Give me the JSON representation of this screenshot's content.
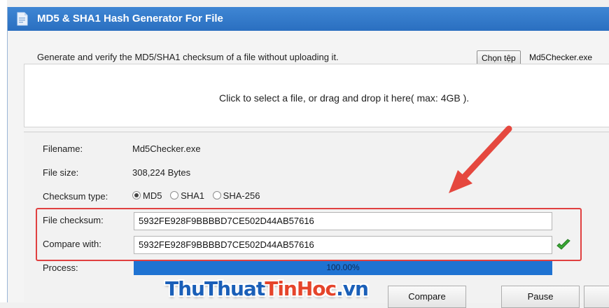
{
  "window": {
    "title": "MD5 & SHA1 Hash Generator For File"
  },
  "header": {
    "description": "Generate and verify the MD5/SHA1 checksum of a file without uploading it.",
    "choose_button_label": "Chọn tệp",
    "chosen_file_name": "Md5Checker.exe"
  },
  "dropzone": {
    "text": "Click to select a file, or drag and drop it here( max: 4GB )."
  },
  "info": {
    "filename_label": "Filename:",
    "filename_value": "Md5Checker.exe",
    "filesize_label": "File size:",
    "filesize_value": "308,224 Bytes",
    "checksum_type_label": "Checksum type:",
    "checksum_types": [
      "MD5",
      "SHA1",
      "SHA-256"
    ],
    "selected_checksum_type": "MD5",
    "file_checksum_label": "File checksum:",
    "file_checksum_value": "5932FE928F9BBBBD7CE502D44AB57616",
    "compare_label": "Compare with:",
    "compare_value": "5932FE928F9BBBBD7CE502D44AB57616",
    "process_label": "Process:",
    "process_text": "100.00%",
    "process_fraction": 1.0
  },
  "buttons": {
    "compare": "Compare",
    "pause": "Pause"
  },
  "watermark": {
    "part1": "ThuThuat",
    "part2": "TinHoc",
    "part3": ".vn"
  },
  "colors": {
    "titlebar": "#2a6fc0",
    "progress": "#1f73d2",
    "highlight_box": "#e04040",
    "arrow": "#e5483f",
    "match_check": "#3aa835"
  },
  "icons": {
    "app": "document-icon",
    "match": "checkmark-icon",
    "annotation": "arrow-icon"
  }
}
